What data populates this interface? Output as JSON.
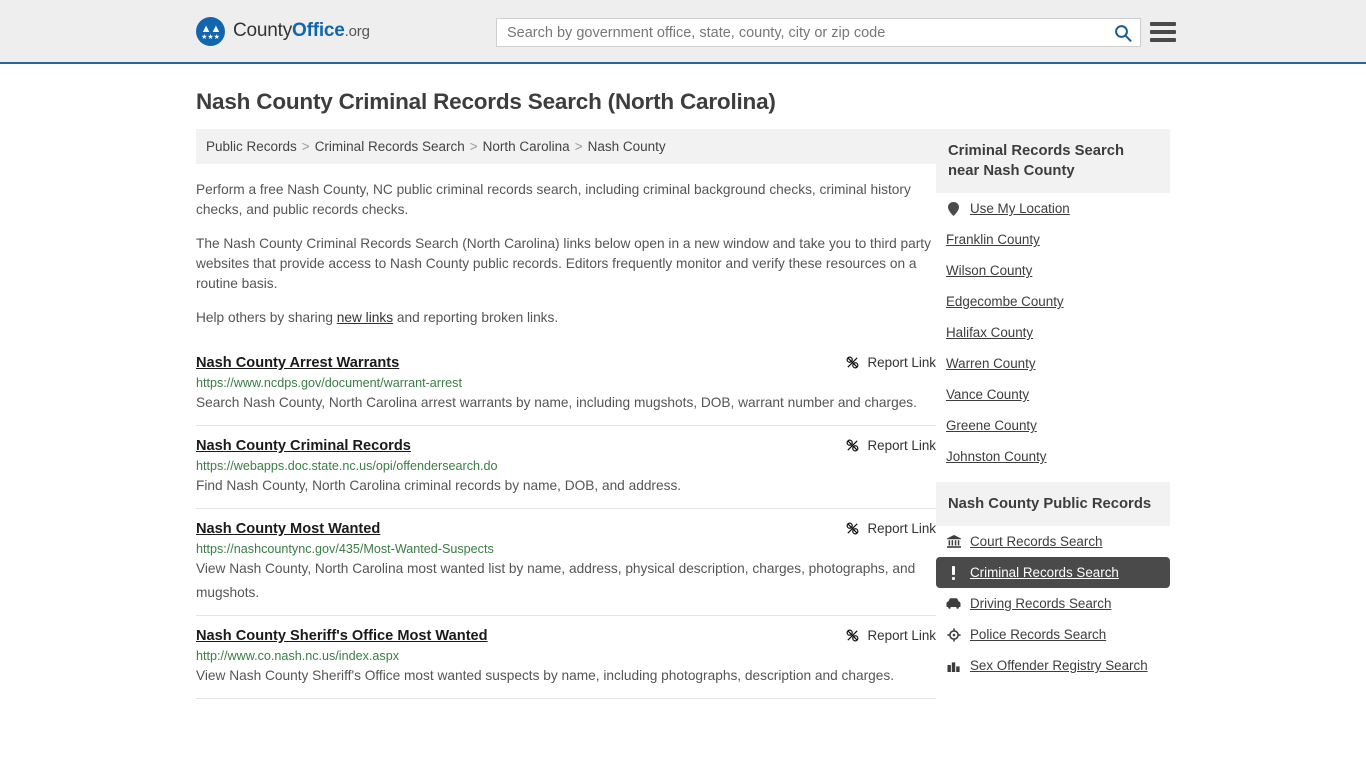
{
  "header": {
    "brand": {
      "part1": "County",
      "part2": "Office",
      "tld": ".org",
      "logo_icon": "eagle-shield-icon"
    },
    "search": {
      "placeholder": "Search by government office, state, county, city or zip code",
      "value": "",
      "button_icon": "search-icon"
    },
    "menu_icon": "hamburger-menu-icon",
    "accent_color": "#2c6496",
    "bg_color": "#eeeeee"
  },
  "page": {
    "title": "Nash County Criminal Records Search (North Carolina)"
  },
  "breadcrumb": {
    "separator": ">",
    "items": [
      {
        "label": "Public Records"
      },
      {
        "label": "Criminal Records Search"
      },
      {
        "label": "North Carolina"
      },
      {
        "label": "Nash County"
      }
    ]
  },
  "intro": {
    "p1": "Perform a free Nash County, NC public criminal records search, including criminal background checks, criminal history checks, and public records checks.",
    "p2": "The Nash County Criminal Records Search (North Carolina) links below open in a new window and take you to third party websites that provide access to Nash County public records. Editors frequently monitor and verify these resources on a routine basis.",
    "p3_before": "Help others by sharing ",
    "p3_link": "new links",
    "p3_after": " and reporting broken links."
  },
  "results": {
    "report_label": "Report Link",
    "report_icon": "broken-link-icon",
    "items": [
      {
        "title": "Nash County Arrest Warrants",
        "url": "https://www.ncdps.gov/document/warrant-arrest",
        "desc": "Search Nash County, North Carolina arrest warrants by name, including mugshots, DOB, warrant number and charges."
      },
      {
        "title": "Nash County Criminal Records",
        "url": "https://webapps.doc.state.nc.us/opi/offendersearch.do",
        "desc": "Find Nash County, North Carolina criminal records by name, DOB, and address."
      },
      {
        "title": "Nash County Most Wanted",
        "url": "https://nashcountync.gov/435/Most-Wanted-Suspects",
        "desc": "View Nash County, North Carolina most wanted list by name, address, physical description, charges, photographs, and mugshots."
      },
      {
        "title": "Nash County Sheriff's Office Most Wanted",
        "url": "http://www.co.nash.nc.us/index.aspx",
        "desc": "View Nash County Sheriff's Office most wanted suspects by name, including photographs, description and charges."
      }
    ]
  },
  "sidebar": {
    "nearby": {
      "heading": "Criminal Records Search near Nash County",
      "items": [
        {
          "label": "Use My Location",
          "icon": "map-pin-icon"
        },
        {
          "label": "Franklin County",
          "icon": ""
        },
        {
          "label": "Wilson County",
          "icon": ""
        },
        {
          "label": "Edgecombe County",
          "icon": ""
        },
        {
          "label": "Halifax County",
          "icon": ""
        },
        {
          "label": "Warren County",
          "icon": ""
        },
        {
          "label": "Vance County",
          "icon": ""
        },
        {
          "label": "Greene County",
          "icon": ""
        },
        {
          "label": "Johnston County",
          "icon": ""
        }
      ]
    },
    "public_records": {
      "heading": "Nash County Public Records",
      "active_index": 1,
      "active_bg": "#4a4a4a",
      "items": [
        {
          "label": "Court Records Search",
          "icon": "courthouse-icon"
        },
        {
          "label": "Criminal Records Search",
          "icon": "exclamation-icon"
        },
        {
          "label": "Driving Records Search",
          "icon": "car-icon"
        },
        {
          "label": "Police Records Search",
          "icon": "police-badge-icon"
        },
        {
          "label": "Sex Offender Registry Search",
          "icon": "buildings-icon"
        }
      ]
    }
  }
}
